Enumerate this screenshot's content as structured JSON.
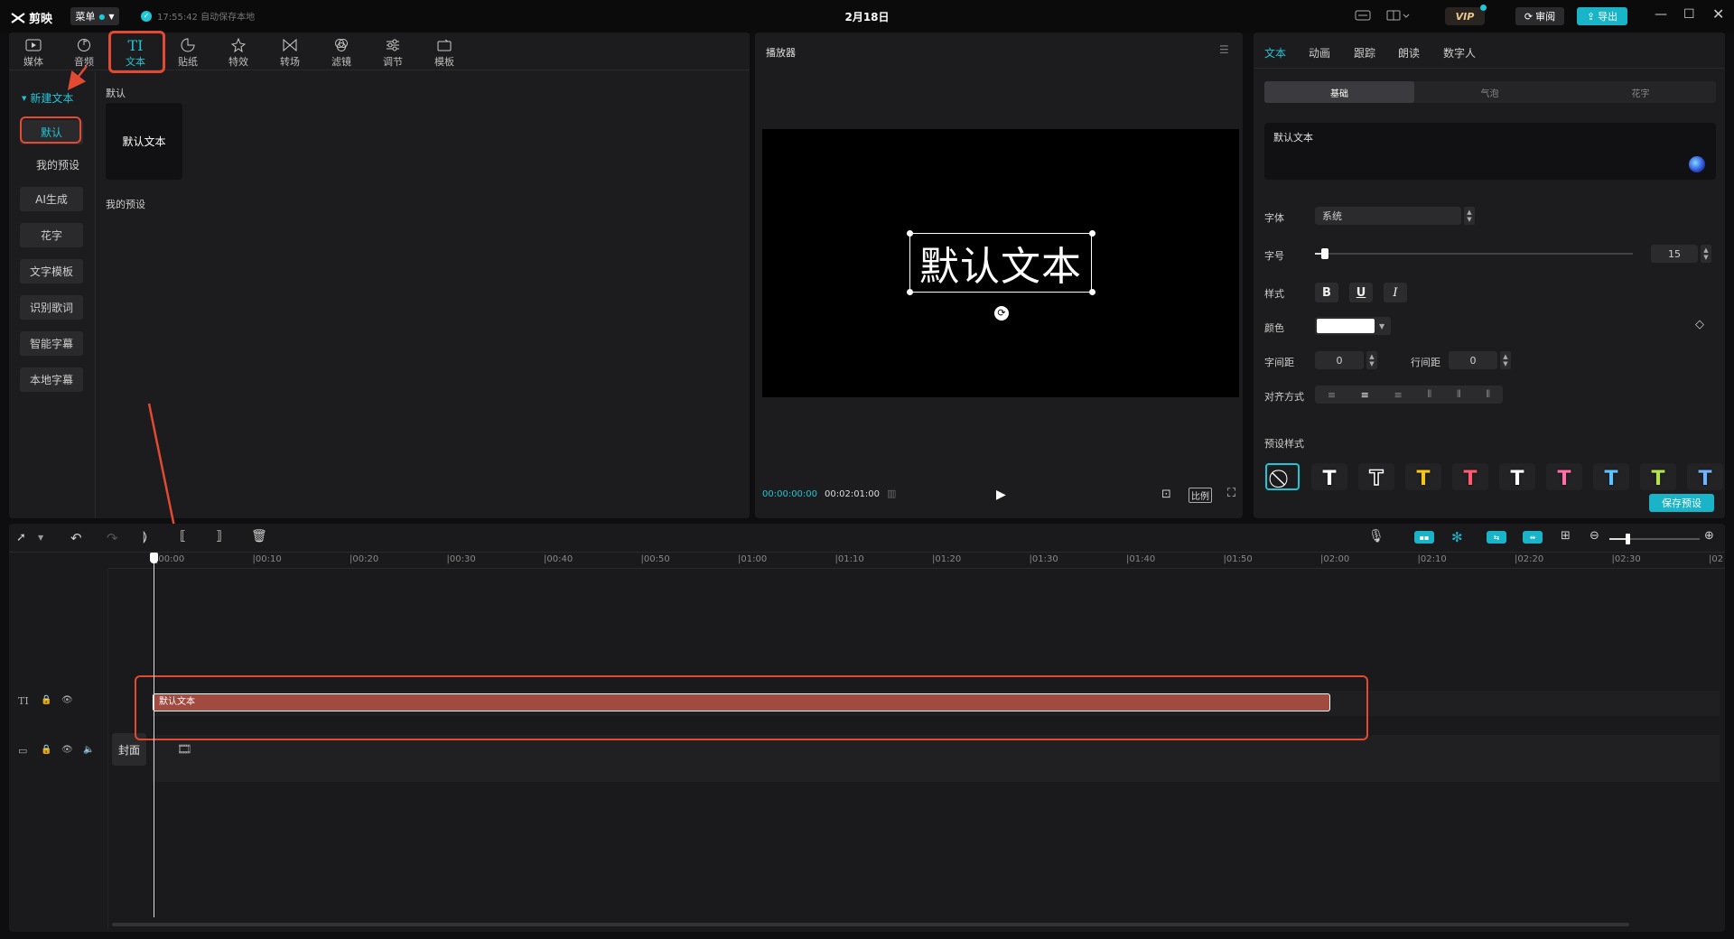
{
  "titlebar": {
    "app_name": "剪映",
    "menu_label": "菜单",
    "autosave": "17:55:42 自动保存本地",
    "project_title": "2月18日",
    "vip": "VIP",
    "review": "审阅",
    "export": "导出"
  },
  "media_tabs": [
    {
      "label": "媒体",
      "icon": "media-icon"
    },
    {
      "label": "音频",
      "icon": "audio-icon"
    },
    {
      "label": "文本",
      "icon": "text-icon"
    },
    {
      "label": "贴纸",
      "icon": "sticker-icon"
    },
    {
      "label": "特效",
      "icon": "effects-icon"
    },
    {
      "label": "转场",
      "icon": "transition-icon"
    },
    {
      "label": "滤镜",
      "icon": "filter-icon"
    },
    {
      "label": "调节",
      "icon": "adjust-icon"
    },
    {
      "label": "模板",
      "icon": "template-icon"
    }
  ],
  "text_sidebar": {
    "new_text": "新建文本",
    "items": [
      "默认",
      "我的预设",
      "AI生成",
      "花字",
      "文字模板",
      "识别歌词",
      "智能字幕",
      "本地字幕"
    ]
  },
  "text_content": {
    "section_default": "默认",
    "default_card": "默认文本",
    "section_presets": "我的预设"
  },
  "player": {
    "title": "播放器",
    "preview_text": "默认文本",
    "current_time": "00:00:00:00",
    "total_time": "00:02:01:00",
    "ratio_label": "比例"
  },
  "inspector": {
    "tabs": [
      "文本",
      "动画",
      "跟踪",
      "朗读",
      "数字人"
    ],
    "subtabs": [
      "基础",
      "气泡",
      "花字"
    ],
    "text_value": "默认文本",
    "font_label": "字体",
    "font_value": "系统",
    "size_label": "字号",
    "size_value": "15",
    "size_fraction": 0.03,
    "style_label": "样式",
    "style_buttons": [
      "B",
      "U",
      "I"
    ],
    "color_label": "颜色",
    "color_value": "#ffffff",
    "letter_spacing_label": "字间距",
    "letter_spacing_value": "0",
    "line_spacing_label": "行间距",
    "line_spacing_value": "0",
    "align_label": "对齐方式",
    "preset_label": "预设样式",
    "save_preset": "保存预设",
    "preset_colors": [
      "#ffffff",
      "#ffffff",
      "#f5c518",
      "#ff5a6e",
      "#ffffff",
      "#ff6fa8",
      "#5bc3ff",
      "#b5e34b",
      "#6fb4ff"
    ]
  },
  "timeline": {
    "ticks": [
      "00:00",
      "00:10",
      "00:20",
      "00:30",
      "00:40",
      "00:50",
      "01:00",
      "01:10",
      "01:20",
      "01:30",
      "01:40",
      "01:50",
      "02:00",
      "02:10",
      "02:20",
      "02:30",
      "02"
    ],
    "text_clip_label": "默认文本",
    "cover_label": "封面"
  },
  "colors": {
    "accent": "#1fc6d6",
    "clip": "#a04a40",
    "highlight": "#e24a32",
    "export_btn": "#19b4c8"
  }
}
